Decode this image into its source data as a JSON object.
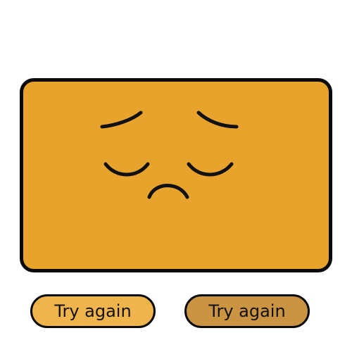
{
  "colors": {
    "card_fill": "#e8a32c",
    "outline": "#0a0a0a",
    "button_left_fill": "#f0b44c",
    "button_right_fill": "#cb9442"
  },
  "face": {
    "expression": "sad"
  },
  "buttons": [
    {
      "label": "Try again",
      "icon": ""
    },
    {
      "label": "Try again",
      "icon": ""
    }
  ]
}
